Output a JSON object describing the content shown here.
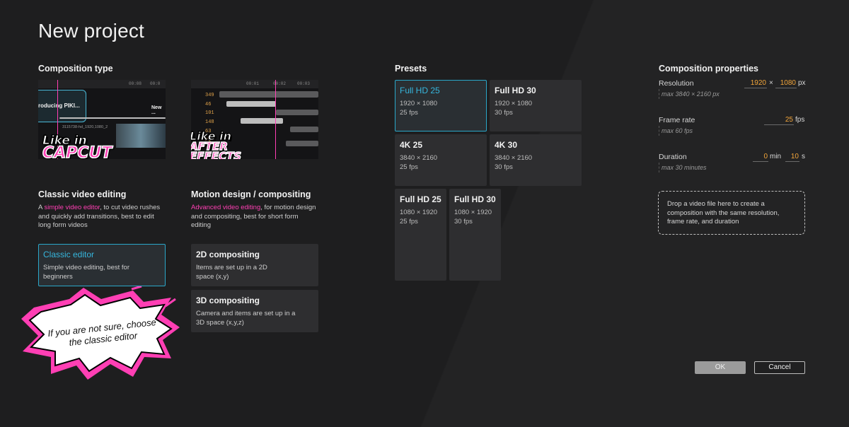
{
  "page": {
    "title": "New project"
  },
  "composition_type": {
    "heading": "Composition type",
    "classic": {
      "title": "Classic video editing",
      "desc_highlight": "simple video editor",
      "desc_pre": "A ",
      "desc_post": ", to cut video rushes and quickly add transitions, best to edit long form videos",
      "sticker_top": "Like in",
      "sticker_bottom": "CAPCUT",
      "thumb_text": "roducing PIKI...",
      "thumb_meta": "3115738-hd_1920,1080_2",
      "thumb_new": "New ...",
      "ticks": [
        "00:08",
        "00:0"
      ],
      "options": [
        {
          "title": "Classic editor",
          "desc": "Simple video editing, best for beginners",
          "selected": true
        }
      ]
    },
    "motion": {
      "title": "Motion design / compositing",
      "desc_highlight": "Advanced video editing",
      "desc_post": ", for motion design and compositing, best for short form editing",
      "sticker_top": "Like in",
      "sticker_bottom": "AFTER EFFECTS",
      "ticks": [
        "00:01",
        "00:02",
        "00:03"
      ],
      "numbers": [
        "349",
        "46",
        "101",
        "148",
        "63",
        "42"
      ],
      "options": [
        {
          "title": "2D compositing",
          "desc": "Items are set up in a 2D space (x,y)"
        },
        {
          "title": "3D compositing",
          "desc": "Camera and items are set up in a 3D space (x,y,z)"
        }
      ]
    },
    "callout": "If you are not sure, choose the classic editor"
  },
  "presets": {
    "heading": "Presets",
    "items": [
      {
        "name": "Full HD 25",
        "size": "1920 × 1080",
        "fps": "25 fps",
        "selected": true
      },
      {
        "name": "Full HD 30",
        "size": "1920 × 1080",
        "fps": "30 fps"
      },
      {
        "name": "4K 25",
        "size": "3840 × 2160",
        "fps": "25 fps"
      },
      {
        "name": "4K 30",
        "size": "3840 × 2160",
        "fps": "30 fps"
      },
      {
        "name": "Full HD 25",
        "size": "1080 × 1920",
        "fps": "25 fps"
      },
      {
        "name": "Full HD 30",
        "size": "1080 × 1920",
        "fps": "30 fps"
      }
    ]
  },
  "properties": {
    "heading": "Composition properties",
    "resolution": {
      "label": "Resolution",
      "width": "1920",
      "times": "×",
      "height": "1080",
      "unit": "px",
      "hint": "max 3840 × 2160 px"
    },
    "frame_rate": {
      "label": "Frame rate",
      "value": "25",
      "unit": "fps",
      "hint": "max 60 fps"
    },
    "duration": {
      "label": "Duration",
      "minutes": "0",
      "min_unit": "min",
      "seconds": "10",
      "sec_unit": "s",
      "hint": "max 30 minutes"
    },
    "dropzone": "Drop a video file here to create a composition with the same resolution, frame rate, and duration"
  },
  "buttons": {
    "ok": "OK",
    "cancel": "Cancel"
  },
  "colors": {
    "accent_blue": "#36b6dd",
    "accent_pink": "#ff3fb4",
    "value_orange": "#f2a53a"
  }
}
